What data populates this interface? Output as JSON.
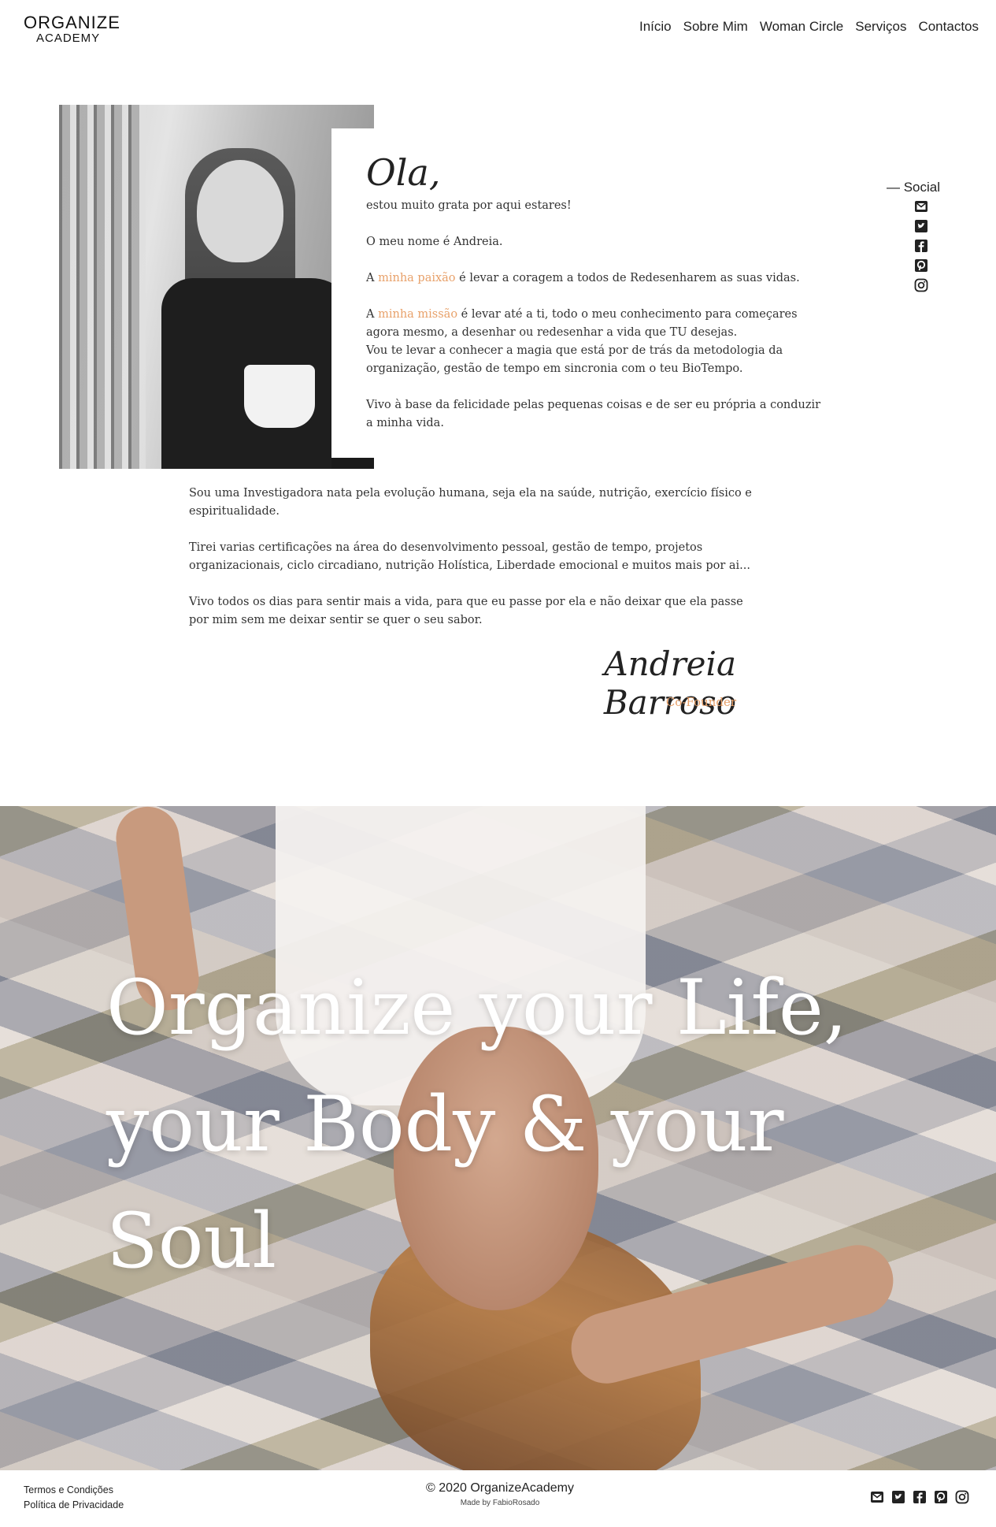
{
  "header": {
    "logo_top": "ORGANIZE",
    "logo_bottom": "ACADEMY",
    "nav": [
      "Início",
      "Sobre Mim",
      "Woman Circle",
      "Serviços",
      "Contactos"
    ]
  },
  "intro": {
    "greeting": "Ola,",
    "line1": "estou muito grata por aqui estares!",
    "line2": "O meu nome é Andreia.",
    "passion_pre": "A ",
    "passion_accent": "minha paixão",
    "passion_post": " é levar a coragem a todos de Redesenharem as suas vidas.",
    "mission_pre": "A ",
    "mission_accent": "minha missão",
    "mission_post": " é levar até a ti, todo o meu conhecimento para começares agora mesmo, a desenhar ou redesenhar a vida que TU desejas.",
    "mission_line2": "Vou te levar a conhecer a magia que está por de trás da metodologia da organização, gestão de tempo em sincronia com o teu BioTempo.",
    "happiness": "Vivo à base da felicidade pelas pequenas coisas e de ser eu própria a conduzir a minha vida."
  },
  "social": {
    "label": "— Social",
    "icons": [
      "mail-icon",
      "twitter-icon",
      "facebook-icon",
      "pinterest-icon",
      "instagram-icon"
    ]
  },
  "bio": {
    "p1": "Sou uma Investigadora nata pela evolução humana, seja ela na saúde, nutrição, exercício físico e espiritualidade.",
    "p2": "Tirei varias certificações na área do desenvolvimento pessoal, gestão de tempo, projetos organizacionais, ciclo circadiano, nutrição Holística, Liberdade emocional e muitos mais por ai...",
    "p3": "Vivo todos os dias para sentir mais a vida, para que eu passe por ela e não deixar que ela passe por mim sem me deixar sentir se quer o seu sabor.",
    "signature": "Andreia Barroso",
    "role": "Co-Founder"
  },
  "hero": {
    "line1": "Organize your Life,",
    "line2": "your Body & your Soul"
  },
  "footer": {
    "terms": "Termos e Condições",
    "privacy": "Política de Privacidade",
    "copyright": "© 2020 OrganizeAcademy",
    "made_by": "Made by FabioRosado"
  },
  "colors": {
    "accent": "#e8a16a",
    "text": "#222222"
  }
}
